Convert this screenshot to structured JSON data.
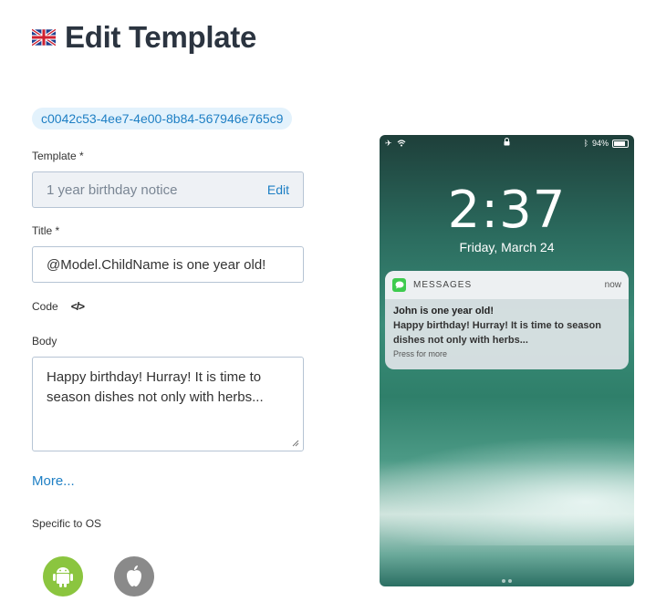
{
  "header": {
    "title": "Edit Template",
    "flag_icon": "uk-flag-icon"
  },
  "template_id": "c0042c53-4ee7-4e00-8b84-567946e765c9",
  "form": {
    "template_label": "Template *",
    "template_value": "1 year birthday notice",
    "template_edit_label": "Edit",
    "title_label": "Title *",
    "title_value": "@Model.ChildName is one year old!",
    "code_label": "Code",
    "code_icon": "code-icon",
    "body_label": "Body",
    "body_value": "Happy birthday! Hurray! It is time to season dishes not only with herbs...",
    "more_label": "More...",
    "os_label": "Specific to OS",
    "os_options": [
      "android-icon",
      "apple-icon"
    ]
  },
  "preview": {
    "status_battery": "94%",
    "time": "2:37",
    "date": "Friday, March 24",
    "notification": {
      "app": "MESSAGES",
      "time": "now",
      "title": "John is one year old!",
      "text": "Happy birthday! Hurray! It is time to season dishes not only with herbs...",
      "hint": "Press for more"
    }
  },
  "colors": {
    "accent": "#1e7fc4",
    "android": "#8bc53f",
    "apple": "#8a8a8a",
    "messages_green": "#3ecb4e"
  }
}
